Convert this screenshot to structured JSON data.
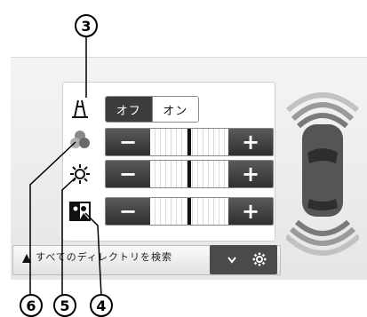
{
  "camera_display": {
    "toggle": {
      "off_label": "オフ",
      "on_label": "オン",
      "selected": "off"
    },
    "sliders": [
      {
        "id": "color",
        "minus_label": "−",
        "plus_label": "+",
        "icon": "color-circles-icon"
      },
      {
        "id": "brightness",
        "minus_label": "−",
        "plus_label": "+",
        "icon": "brightness-icon"
      },
      {
        "id": "contrast",
        "minus_label": "−",
        "plus_label": "+",
        "icon": "contrast-icon"
      }
    ],
    "guide_icon": "parking-guideline-icon",
    "search": {
      "text": "すべてのディレクトリを検索"
    },
    "settings_icon": "gear-icon",
    "dropdown_icon": "chevron-down-icon"
  },
  "callouts": {
    "c3": "3",
    "c6": "6",
    "c5": "5",
    "c4": "4"
  },
  "colors": {
    "dark_button": "#3c3c3c",
    "sensor_arc": "#9a9a9a",
    "car_body": "#555555"
  }
}
